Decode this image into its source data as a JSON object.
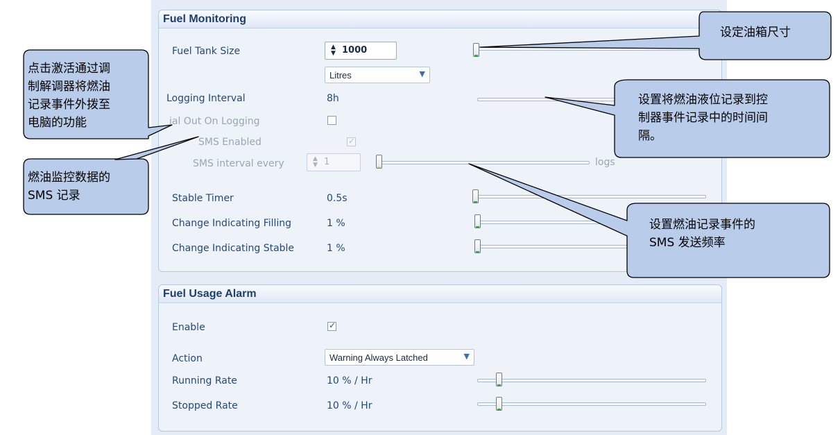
{
  "fuel_monitoring": {
    "title": "Fuel Monitoring",
    "fuel_tank_size": {
      "label": "Fuel Tank Size",
      "value": "1000",
      "unit": "Litres"
    },
    "logging_interval": {
      "label": "Logging Interval",
      "value": "8h"
    },
    "dial_out": {
      "label": "ial Out On Logging",
      "checked": false
    },
    "sms_enabled": {
      "label": "SMS Enabled",
      "checked": true
    },
    "sms_interval": {
      "label": "SMS interval every",
      "value": "1",
      "unit": "logs"
    },
    "stable_timer": {
      "label": "Stable Timer",
      "value": "0.5s"
    },
    "change_filling": {
      "label": "Change Indicating Filling",
      "value": "1 %"
    },
    "change_stable": {
      "label": "Change Indicating Stable",
      "value": "1 %"
    }
  },
  "fuel_usage_alarm": {
    "title": "Fuel Usage Alarm",
    "enable": {
      "label": "Enable",
      "checked": true
    },
    "action": {
      "label": "Action",
      "value": "Warning Always Latched"
    },
    "running_rate": {
      "label": "Running Rate",
      "value": "10 % / Hr"
    },
    "stopped_rate": {
      "label": "Stopped Rate",
      "value": "10 % / Hr"
    }
  },
  "callouts": {
    "tank_size": "设定油箱尺寸",
    "dial_out": [
      "点击激活通过调",
      "制解调器将燃油",
      "记录事件外拨至",
      "电脑的功能"
    ],
    "sms_log": [
      "燃油监控数据的",
      "SMS 记录"
    ],
    "logging_interval": [
      "设置将燃油液位记录到控",
      "制器事件记录中的时间间",
      "隔。"
    ],
    "sms_rate": [
      "设置燃油记录事件的",
      "SMS 发送频率"
    ]
  },
  "icons": {
    "checked": "check-mark-icon",
    "dropdown": "chevron-down-icon",
    "spin": "spin-arrows-icon"
  },
  "colors": {
    "callout_fill": "#b9cdea",
    "slider_accent": "#2eb135",
    "panel_bg": "#eef3fa"
  }
}
